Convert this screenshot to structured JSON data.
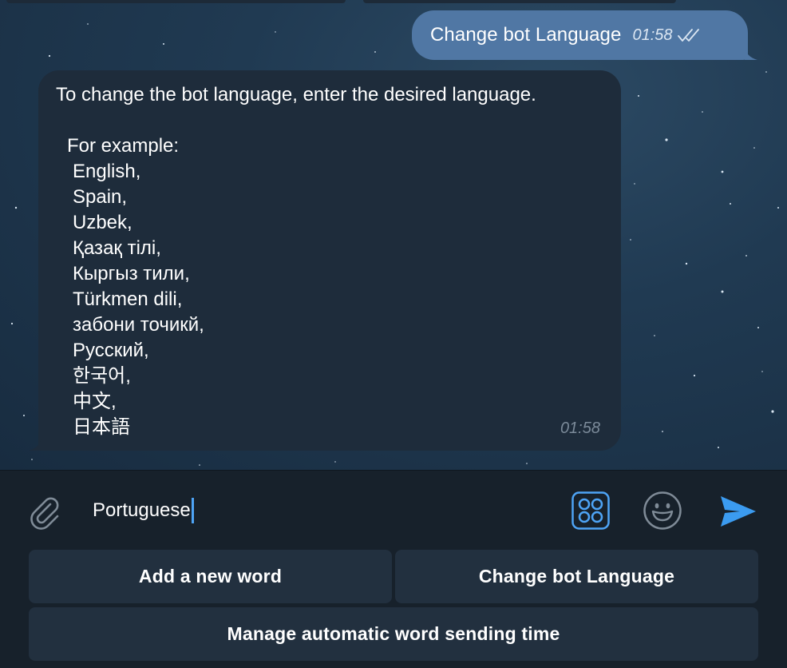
{
  "chat": {
    "outgoing": {
      "text": "Change bot Language",
      "time": "01:58",
      "status_icon": "double-check-icon"
    },
    "incoming": {
      "intro": "To change the bot language, enter the desired language.",
      "example_heading": "For example:",
      "languages": [
        "English,",
        "Spain,",
        "Uzbek,",
        "Қазақ тілі,",
        "Кыргыз тили,",
        "Türkmen dili,",
        "забони точикй,",
        "Русский,",
        "한국어,",
        "中文,",
        "日本語"
      ],
      "time": "01:58"
    }
  },
  "input": {
    "value": "Portuguese",
    "attach_icon": "paperclip-icon",
    "commands_icon": "bot-commands-icon",
    "emoji_icon": "smiley-icon",
    "send_icon": "send-icon"
  },
  "keyboard": {
    "buttons": [
      "Add a new word",
      "Change bot Language",
      "Manage automatic word sending time"
    ]
  },
  "colors": {
    "outgoing_bubble": "#5077a4",
    "incoming_bubble": "#1e2c3b",
    "accent": "#4ea4f6",
    "panel": "#17212b",
    "keyboard_button": "#22303f"
  }
}
